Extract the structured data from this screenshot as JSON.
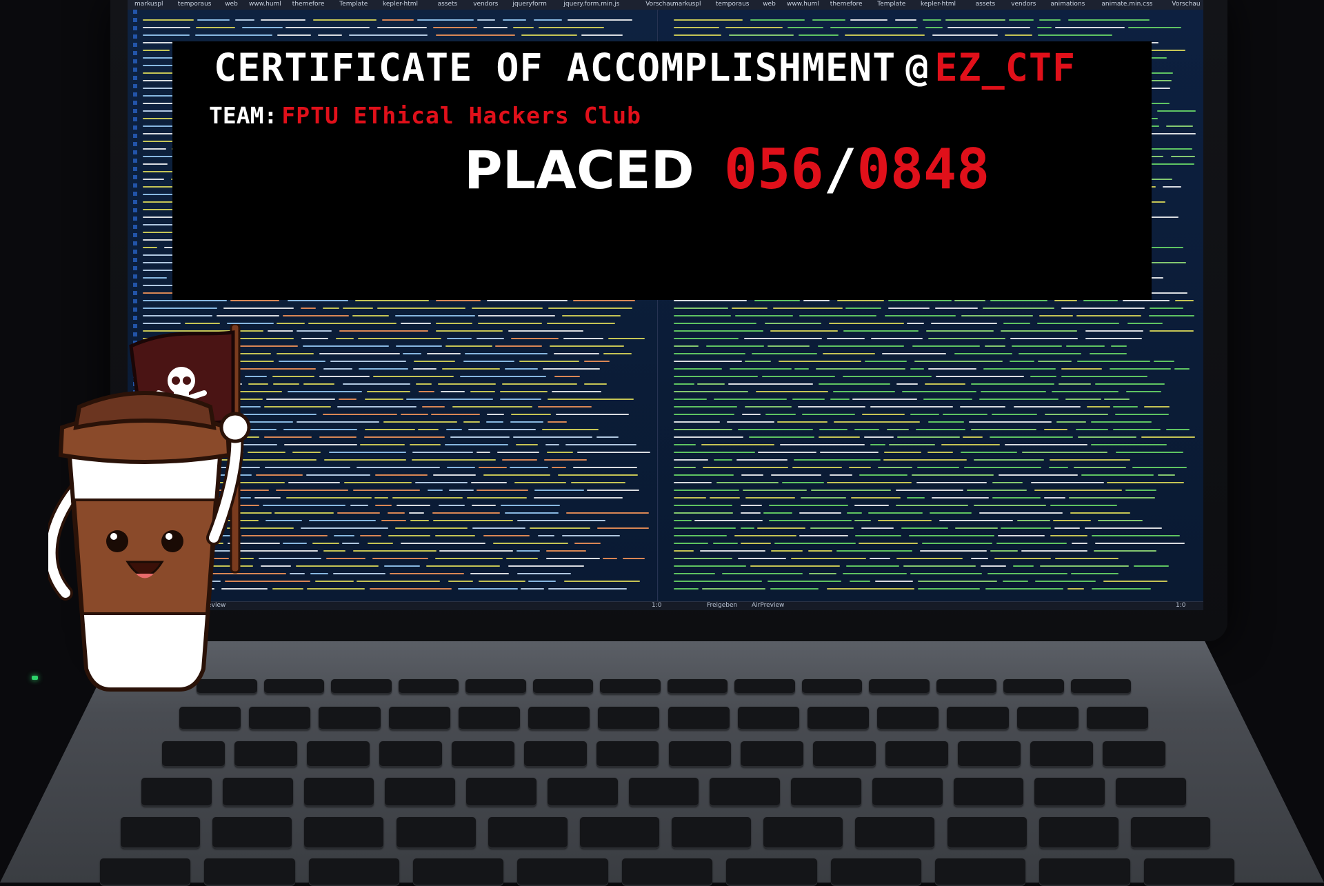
{
  "certificate": {
    "title": "CERTIFICATE OF ACCOMPLISHMENT",
    "at_symbol": "@",
    "event": "EZ_CTF",
    "team_label": "TEAM:",
    "team_name": "FPTU EThical Hackers Club",
    "placed_label": "PLACED",
    "rank_position": "056",
    "rank_separator": "/",
    "rank_total": "0848"
  },
  "editor": {
    "left_tabs": [
      "markuspl",
      "temporaus",
      "web",
      "www.huml",
      "themefore",
      "Template",
      "kepler-html",
      "assets",
      "vendors",
      "jqueryform",
      "jquery.form.min.js",
      "Vorschau"
    ],
    "right_tabs": [
      "markuspl",
      "temporaus",
      "web",
      "www.huml",
      "themefore",
      "Template",
      "kepler-html",
      "assets",
      "vendors",
      "animations",
      "animate.min.css",
      "Vorschau"
    ],
    "status_left_position": "1:0",
    "status_right_items": [
      "Freigeben",
      "AirPreview"
    ],
    "status_left_preview": "AirPreview",
    "status_right_position": "1:0"
  },
  "mascot": {
    "name": "coffee-cup-mascot",
    "flag_icon": "skull-and-crossbones-icon"
  },
  "colors": {
    "accent_red": "#e0101a",
    "overlay_background": "#000000",
    "code_green": "#6ee26a",
    "code_yellow": "#e8e35a",
    "screen_blue": "#0d1f3a"
  }
}
